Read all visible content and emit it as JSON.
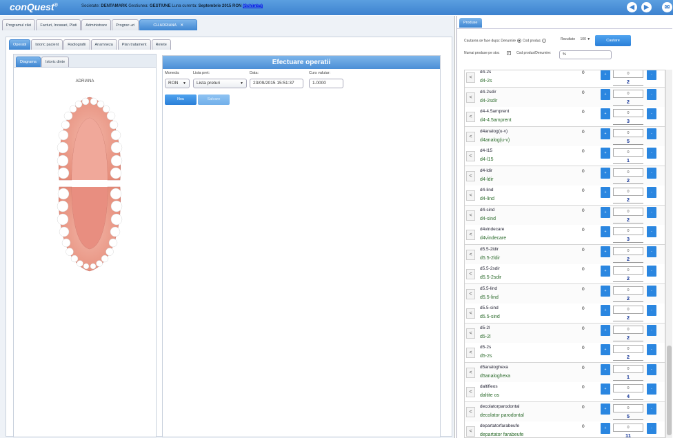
{
  "app": {
    "logo": "conQuest",
    "logo_mark": "®"
  },
  "company": {
    "societate_label": "Societate:",
    "societate": "DENTAMARK",
    "gestiune_label": "Gestiunea:",
    "gestiune": "GESTIUNE",
    "luna_label": "Luna curenta:",
    "luna": "Septembrie 2015 RON",
    "schimba": "(Schimba)"
  },
  "top_icons": [
    "back-icon",
    "forward-icon",
    "mail-icon"
  ],
  "main_tabs": [
    "Programul zilei",
    "Facturi, Incasari, Plati",
    "Administrare",
    "Programari",
    "CH ADRIANA"
  ],
  "sub_tabs": [
    "Operatii",
    "Istoric pacient",
    "Radiografii",
    "Anamneza",
    "Plan tratament",
    "Retete"
  ],
  "diag_tabs": [
    "Diagrama",
    "Istoric dinte"
  ],
  "patient_name": "ADRIANA",
  "operatii": {
    "title": "Efectuare operatii",
    "moneda_label": "Moneda:",
    "moneda": "RON",
    "lista_label": "Lista pret:",
    "lista": "Lista preturi",
    "data_label": "Data:",
    "data": "23/09/2015 15:51:37",
    "curs_label": "Curs valutar:",
    "curs": "1.0000",
    "nou_button": "Nou",
    "salvare_button": "Salvare"
  },
  "produse": {
    "tab": "Produse",
    "cautarea_label": "Cautarea se face dupa: Denumire",
    "cod_produs": "Cod produs",
    "rezultate_label": "Rezultate",
    "rezultate": "100",
    "cautare_button": "Cautare",
    "stoc_label": "Numai produse pe stoc",
    "cod_den_label": "Cod produs/Denumire:",
    "search_value": "%",
    "items": [
      {
        "code": "d4-2s",
        "name": "d4-2s",
        "stock": "0",
        "qty": "0",
        "count": "2"
      },
      {
        "code": "d4-2sdir",
        "name": "d4-2sdir",
        "stock": "0",
        "qty": "0",
        "count": "2"
      },
      {
        "code": "d4-4.5amprent",
        "name": "d4-4.5amprent",
        "stock": "0",
        "qty": "0",
        "count": "3"
      },
      {
        "code": "d4analog(u-v)",
        "name": "d4analog(u-v)",
        "stock": "0",
        "qty": "0",
        "count": "5"
      },
      {
        "code": "d4-l15",
        "name": "d4-l15",
        "stock": "0",
        "qty": "0",
        "count": "1"
      },
      {
        "code": "d4-ldir",
        "name": "d4-ldir",
        "stock": "0",
        "qty": "0",
        "count": "2"
      },
      {
        "code": "d4-lind",
        "name": "d4-lind",
        "stock": "0",
        "qty": "0",
        "count": "2"
      },
      {
        "code": "d4-sind",
        "name": "d4-sind",
        "stock": "0",
        "qty": "0",
        "count": "2"
      },
      {
        "code": "d4vindecare",
        "name": "d4vindecare",
        "stock": "0",
        "qty": "0",
        "count": "3"
      },
      {
        "code": "d5.5-2ldir",
        "name": "d5.5-2ldir",
        "stock": "0",
        "qty": "0",
        "count": "2"
      },
      {
        "code": "d5.5-2sdir",
        "name": "d5.5-2sdir",
        "stock": "0",
        "qty": "0",
        "count": "2"
      },
      {
        "code": "d5.5-lind",
        "name": "d5.5-lind",
        "stock": "0",
        "qty": "0",
        "count": "2"
      },
      {
        "code": "d5.5-sind",
        "name": "d5.5-sind",
        "stock": "0",
        "qty": "0",
        "count": "2"
      },
      {
        "code": "d5-2l",
        "name": "d5-2l",
        "stock": "0",
        "qty": "0",
        "count": "2"
      },
      {
        "code": "d5-2s",
        "name": "d5-2s",
        "stock": "0",
        "qty": "0",
        "count": "2"
      },
      {
        "code": "d5analoghexa",
        "name": "d5analoghexa",
        "stock": "0",
        "qty": "0",
        "count": "1"
      },
      {
        "code": "daltifieos",
        "name": "daltite os",
        "stock": "0",
        "qty": "0",
        "count": "4"
      },
      {
        "code": "decolatorparodontal",
        "name": "decolator parodontal",
        "stock": "0",
        "qty": "0",
        "count": "5"
      },
      {
        "code": "departatorfarabeufe",
        "name": "departator farabeufe",
        "stock": "0",
        "qty": "0",
        "count": "11"
      }
    ]
  },
  "colors": {
    "accent": "#3f86d2",
    "header": "#4b8fd6",
    "green_text": "#2a6a2a",
    "count_text": "#1a3a9a"
  }
}
